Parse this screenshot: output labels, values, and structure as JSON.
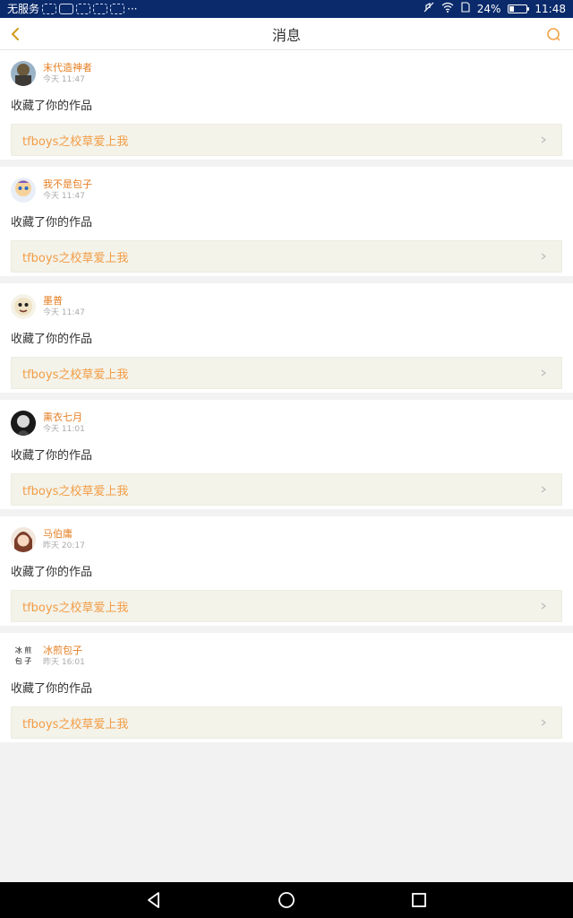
{
  "status_bar": {
    "carrier": "无服务",
    "more": "···",
    "battery_level": 0.24,
    "battery_text": "24%",
    "time": "11:48"
  },
  "header": {
    "title": "消息",
    "back_icon": "chevron-left-icon",
    "search_icon": "search-icon",
    "accent_color": "#e67e22"
  },
  "messages": [
    {
      "name": "末代造神者",
      "time": "今天 11:47",
      "action": "收藏了你的作品",
      "work": "tfboys之校草爱上我",
      "avatar": "avatar-1"
    },
    {
      "name": "我不是包子",
      "time": "今天 11:47",
      "action": "收藏了你的作品",
      "work": "tfboys之校草爱上我",
      "avatar": "avatar-2"
    },
    {
      "name": "墨普",
      "time": "今天 11:47",
      "action": "收藏了你的作品",
      "work": "tfboys之校草爱上我",
      "avatar": "avatar-3"
    },
    {
      "name": "熏衣七月",
      "time": "今天 11:01",
      "action": "收藏了你的作品",
      "work": "tfboys之校草爱上我",
      "avatar": "avatar-4"
    },
    {
      "name": "马伯庸",
      "time": "昨天 20:17",
      "action": "收藏了你的作品",
      "work": "tfboys之校草爱上我",
      "avatar": "avatar-5"
    },
    {
      "name": "冰煎包子",
      "time": "昨天 16:01",
      "action": "收藏了你的作品",
      "work": "tfboys之校草爱上我",
      "avatar": "avatar-6",
      "avatar_text": "冰煎包子"
    }
  ],
  "nav": {
    "back_icon": "triangle-back-icon",
    "home_icon": "circle-home-icon",
    "recents_icon": "square-recents-icon"
  }
}
